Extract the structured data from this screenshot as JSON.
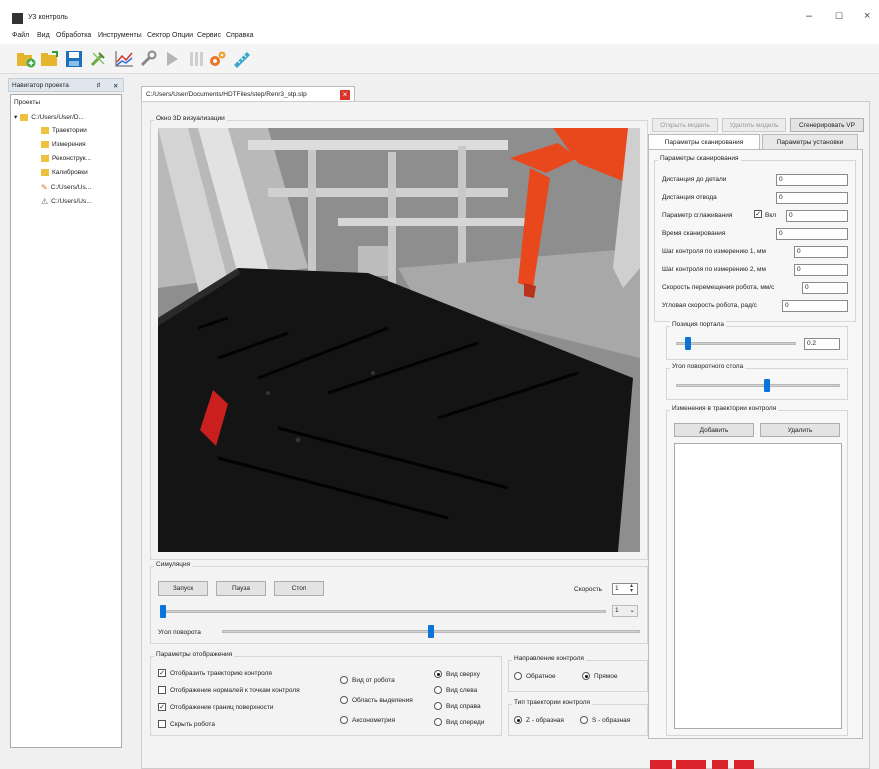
{
  "window": {
    "title": "УЗ контроль",
    "minimize": "–",
    "maximize": "☐",
    "close": "×"
  },
  "menu": [
    "Файл",
    "Вид",
    "Обработка",
    "Инструменты",
    "Сектор",
    "Опции",
    "Сервис",
    "Справка"
  ],
  "toolbar_icons": [
    "new-project-icon",
    "open-folder-icon",
    "save-icon",
    "tools-icon",
    "chart-icon",
    "wrench-icon",
    "play-icon",
    "pause-bars-icon",
    "gears-icon",
    "ruler-icon"
  ],
  "project_navigator": {
    "title": "Навигатор проекта",
    "pin": "♯",
    "close": "✕",
    "root_label": "Проекты",
    "project_path": "C:/Users/User/D...",
    "items": [
      "Траектории",
      "Измерения",
      "Реконструк...",
      "Калибровки"
    ],
    "files": [
      "C:/Users/Us...",
      "C:/Users/Us..."
    ]
  },
  "document_tab": {
    "path": "C:/Users/User/Documents/HDTFiles/step/Renr3_stp.stp",
    "close": "×"
  },
  "viewport": {
    "title": "Окно 3D визуализации"
  },
  "top_buttons": {
    "open_model": "Открыть модель",
    "delete_model": "Удалить модель",
    "generate_vp": "Сгенерировать VP"
  },
  "params_tabs": [
    "Параметры сканирования",
    "Параметры установки"
  ],
  "scan_params": {
    "title": "Параметры сканирования",
    "fields": [
      {
        "label": "Дистанция до детали",
        "value": "0"
      },
      {
        "label": "Дистанция отвода",
        "value": "0"
      },
      {
        "label": "Параметр сглаживания",
        "value": "0",
        "checkbox_label": "Вкл",
        "checked": true
      },
      {
        "label": "Время сканирования",
        "value": "0"
      },
      {
        "label": "Шаг контроля по измерению 1, мм",
        "value": "0"
      },
      {
        "label": "Шаг контроля по измерению 2, мм",
        "value": "0"
      },
      {
        "label": "Скорость перемещения робота, мм/с",
        "value": "0"
      },
      {
        "label": "Угловая скорость робота, рад/с",
        "value": "0"
      }
    ]
  },
  "portal": {
    "title": "Позиция портала",
    "value": "0.2",
    "level": 0.08
  },
  "rotary_table": {
    "title": "Угол поворотного стола",
    "level": 0.56
  },
  "trajectory_changes": {
    "title": "Изменения в траектории контроля",
    "add": "Добавить",
    "remove": "Удалить"
  },
  "simulation": {
    "title": "Симуляция",
    "start": "Запуск",
    "pause": "Пауза",
    "stop": "Стоп",
    "speed_label": "Скорость",
    "speed_value": "1",
    "combo_value": "1",
    "progress_level": 0.0,
    "rotation_label": "Угол поворота",
    "rotation_level": 0.5
  },
  "display_params": {
    "title": "Параметры отображения",
    "checkboxes": [
      {
        "label": "Отобразить траекторию контроля",
        "checked": true
      },
      {
        "label": "Отображение нормалей к точкам контроля",
        "checked": false
      },
      {
        "label": "Отображение границ поверхности",
        "checked": true
      },
      {
        "label": "Скрыть робота",
        "checked": false
      }
    ],
    "view_radios_a": [
      {
        "label": "Вид от робота",
        "on": false
      },
      {
        "label": "Область выделения",
        "on": false
      },
      {
        "label": "Аксонометрия",
        "on": false
      }
    ],
    "view_radios_b": [
      {
        "label": "Вид сверху",
        "on": true
      },
      {
        "label": "Вид слева",
        "on": false
      },
      {
        "label": "Вид справа",
        "on": false
      },
      {
        "label": "Вид спереди",
        "on": false
      }
    ]
  },
  "control_direction": {
    "title": "Направление контроля",
    "options": [
      {
        "label": "Обратное",
        "on": false
      },
      {
        "label": "Прямое",
        "on": true
      }
    ]
  },
  "trajectory_type": {
    "title": "Тип траектории контроля",
    "options": [
      {
        "label": "Z - образная",
        "on": true
      },
      {
        "label": "S - образная",
        "on": false
      }
    ]
  },
  "colors": {
    "robot": "#e8481c",
    "marker": "#c91f1f",
    "slider": "#0a74da",
    "table": "#141414"
  }
}
